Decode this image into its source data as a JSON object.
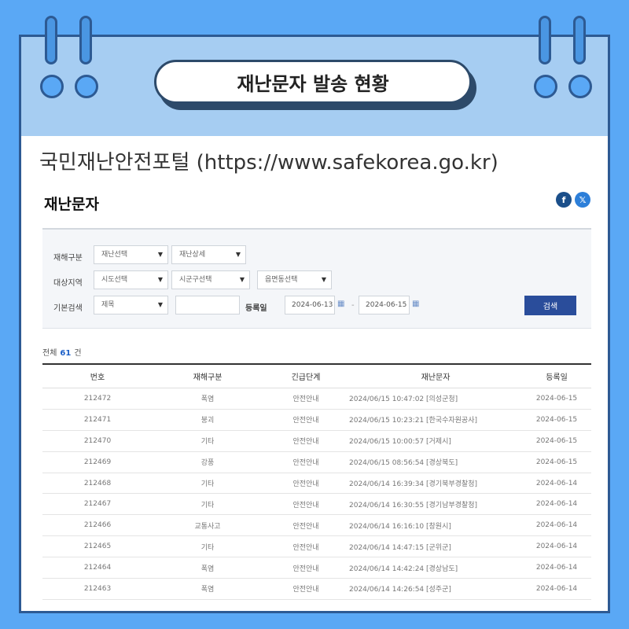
{
  "header": {
    "title": "재난문자 발송 현황"
  },
  "portal": {
    "title": "국민재난안전포털 (https://www.safekorea.go.kr)"
  },
  "page": {
    "heading": "재난문자"
  },
  "social": {
    "facebook": "f",
    "x": "𝕏"
  },
  "filter": {
    "disaster_type_label": "재해구분",
    "disaster_select": "재난선택",
    "disaster_detail": "재난상세",
    "region_label": "대상지역",
    "sido_select": "시도선택",
    "sigungu_select": "시군구선택",
    "eupmyeondong_select": "읍면동선택",
    "basic_search_label": "기본검색",
    "field_select": "제목",
    "keyword_value": "",
    "reg_date_label": "등록일",
    "date_from": "2024-06-13",
    "date_separator": "-",
    "date_to": "2024-06-15",
    "search_button": "검색"
  },
  "summary": {
    "prefix": "전체",
    "count": "61",
    "suffix": "건"
  },
  "table": {
    "headers": [
      "번호",
      "재해구분",
      "긴급단계",
      "재난문자",
      "등록일"
    ],
    "rows": [
      [
        "212472",
        "폭염",
        "안전안내",
        "2024/06/15 10:47:02 [의성군청]",
        "2024-06-15"
      ],
      [
        "212471",
        "붕괴",
        "안전안내",
        "2024/06/15 10:23:21 [한국수자원공사]",
        "2024-06-15"
      ],
      [
        "212470",
        "기타",
        "안전안내",
        "2024/06/15 10:00:57 [거제시]",
        "2024-06-15"
      ],
      [
        "212469",
        "강풍",
        "안전안내",
        "2024/06/15 08:56:54 [경상북도]",
        "2024-06-15"
      ],
      [
        "212468",
        "기타",
        "안전안내",
        "2024/06/14 16:39:34 [경기북부경찰청]",
        "2024-06-14"
      ],
      [
        "212467",
        "기타",
        "안전안내",
        "2024/06/14 16:30:55 [경기남부경찰청]",
        "2024-06-14"
      ],
      [
        "212466",
        "교통사고",
        "안전안내",
        "2024/06/14 16:16:10 [창원시]",
        "2024-06-14"
      ],
      [
        "212465",
        "기타",
        "안전안내",
        "2024/06/14 14:47:15 [군위군]",
        "2024-06-14"
      ],
      [
        "212464",
        "폭염",
        "안전안내",
        "2024/06/14 14:42:24 [경상남도]",
        "2024-06-14"
      ],
      [
        "212463",
        "폭염",
        "안전안내",
        "2024/06/14 14:26:54 [성주군]",
        "2024-06-14"
      ]
    ]
  },
  "colors": {
    "background": "#5aa8f5",
    "header_band": "#a6cdf2",
    "accent_button": "#2a4d9b",
    "count": "#1d60c8"
  }
}
